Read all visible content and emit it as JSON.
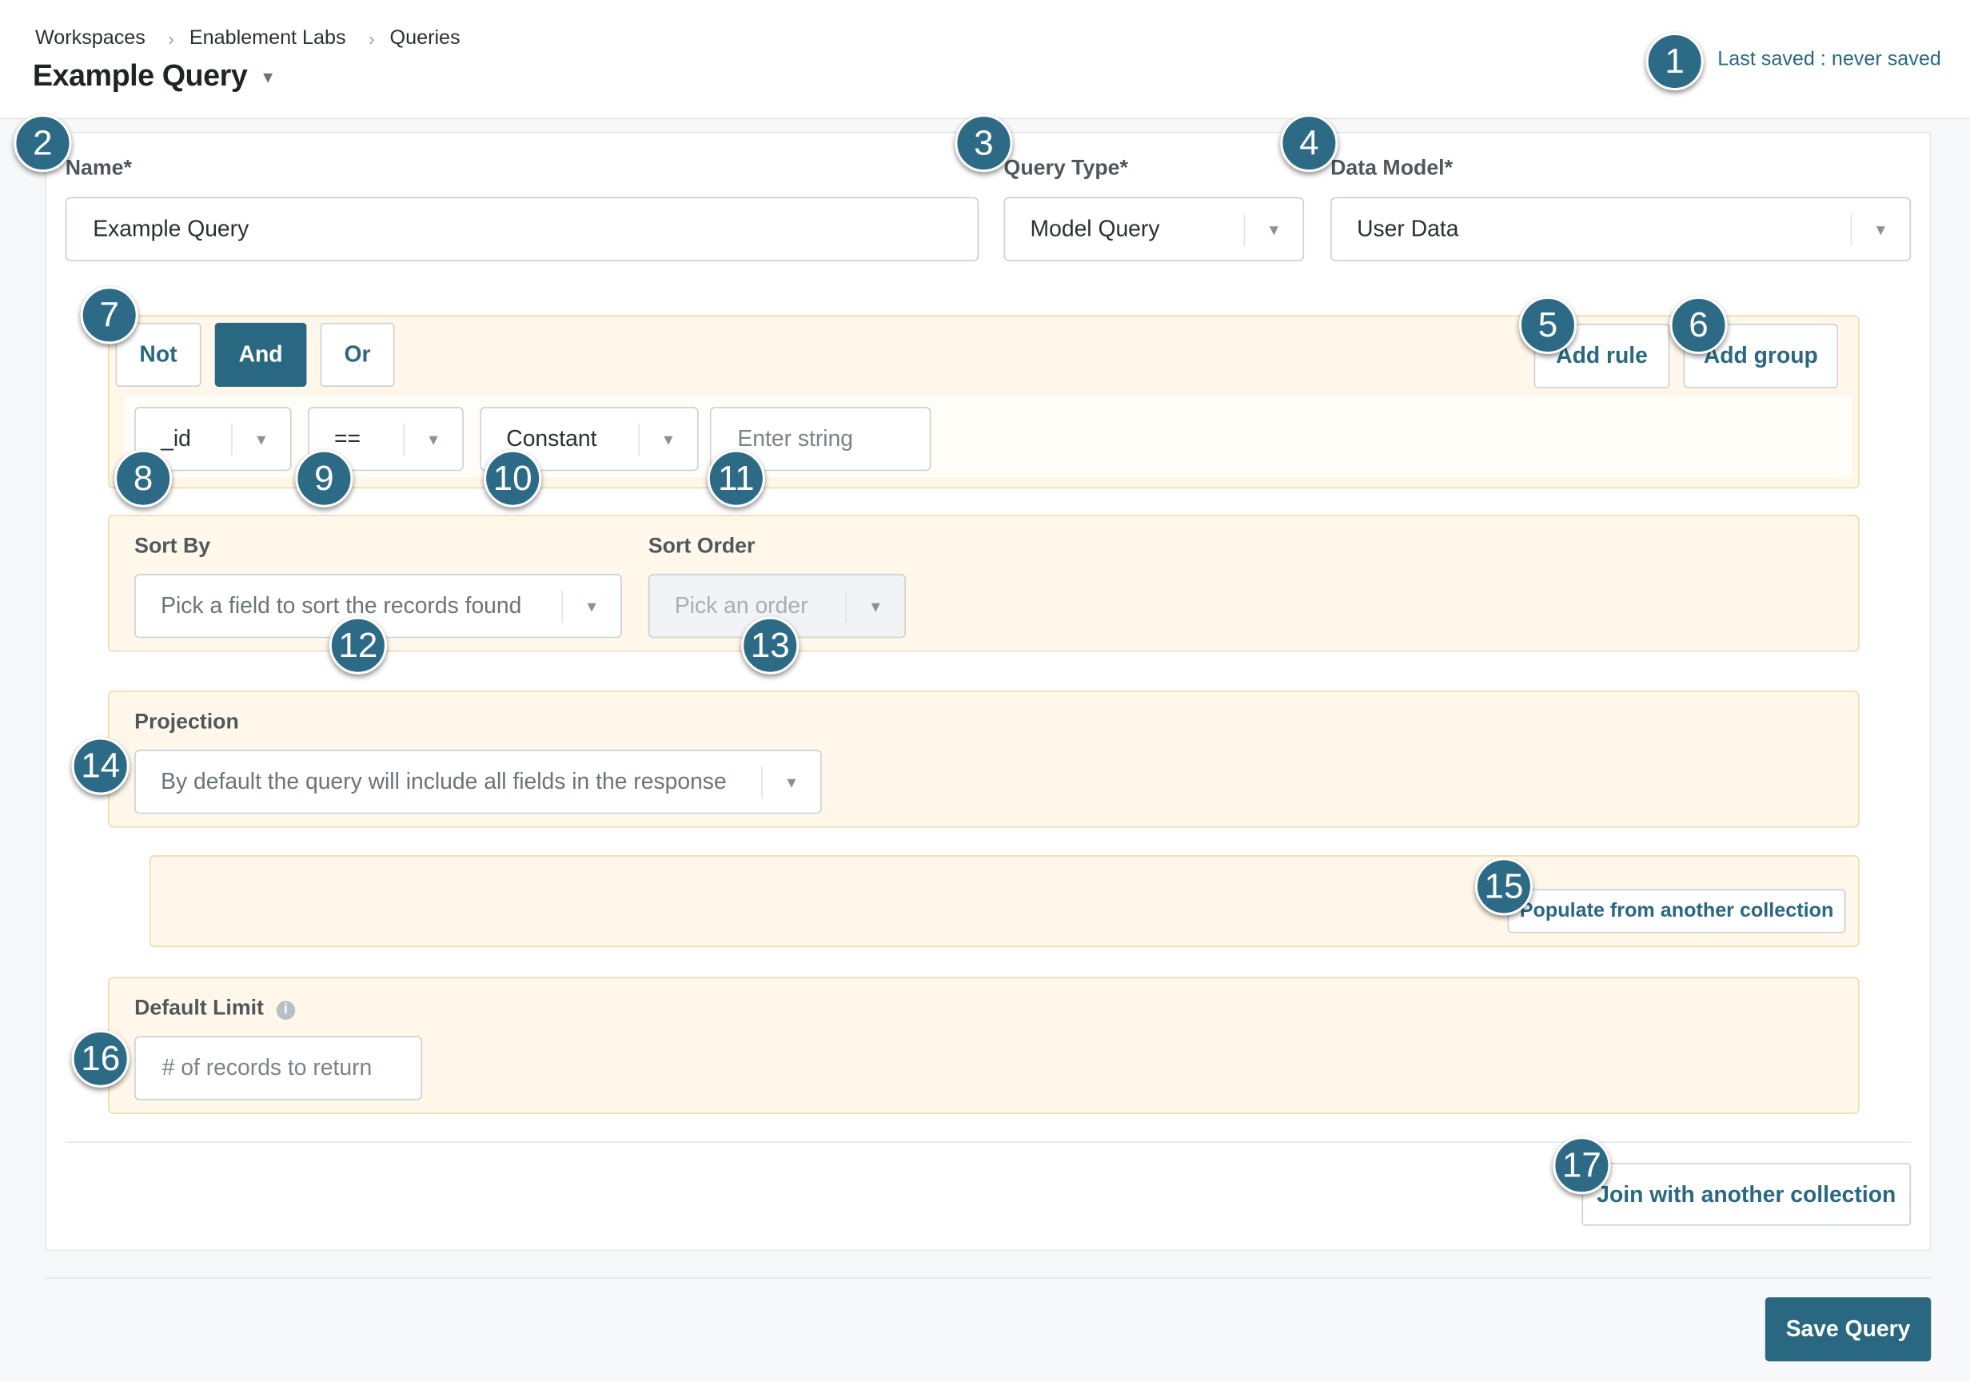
{
  "breadcrumb": [
    "Workspaces",
    "Enablement Labs",
    "Queries"
  ],
  "page_title": "Example Query",
  "last_saved": "Last saved : never saved",
  "form": {
    "name_label": "Name*",
    "name_value": "Example Query",
    "query_type_label": "Query Type*",
    "query_type_value": "Model Query",
    "data_model_label": "Data Model*",
    "data_model_value": "User Data"
  },
  "rule_group": {
    "combinators": [
      "Not",
      "And",
      "Or"
    ],
    "active_combinator": "And",
    "add_rule": "Add rule",
    "add_group": "Add group",
    "rule": {
      "field": "_id",
      "operator": "==",
      "value_source": "Constant",
      "value_placeholder": "Enter string"
    }
  },
  "sort": {
    "sort_by_label": "Sort By",
    "sort_by_placeholder": "Pick a field to sort the records found",
    "sort_order_label": "Sort Order",
    "sort_order_placeholder": "Pick an order"
  },
  "projection": {
    "label": "Projection",
    "placeholder": "By default the query will include all fields in the response"
  },
  "populate_button": "Populate from another collection",
  "default_limit": {
    "label": "Default Limit",
    "placeholder": "# of records to return"
  },
  "join_button": "Join with another collection",
  "save_button": "Save Query",
  "badges": [
    "1",
    "2",
    "3",
    "4",
    "5",
    "6",
    "7",
    "8",
    "9",
    "10",
    "11",
    "12",
    "13",
    "14",
    "15",
    "16",
    "17"
  ],
  "colors": {
    "accent": "#2a6882",
    "badge": "#2d6a85",
    "group_bg": "#fff8ea",
    "group_border": "#f0d9ad"
  },
  "icons": [
    "chevron-right-icon",
    "caret-down-icon",
    "info-icon"
  ]
}
